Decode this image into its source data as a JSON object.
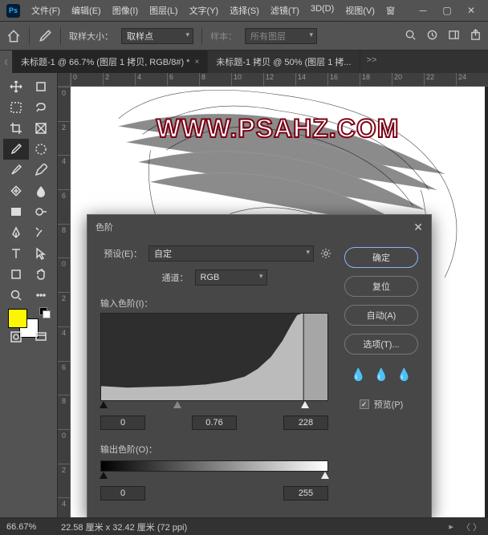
{
  "app": {
    "logo": "Ps"
  },
  "menu": {
    "file": "文件(F)",
    "edit": "编辑(E)",
    "image": "图像(I)",
    "layer": "图层(L)",
    "type": "文字(Y)",
    "select": "选择(S)",
    "filter": "滤镜(T)",
    "three_d": "3D(D)",
    "view": "视图(V)",
    "window": "窗"
  },
  "options": {
    "sample_size_label": "取样大小：",
    "sample_size_value": "取样点",
    "sample_label": "样本：",
    "sample_value": "所有图层"
  },
  "tabs": {
    "t1": "未标题-1 @ 66.7% (图层 1 拷贝, RGB/8#) *",
    "t2": "未标题-1 拷贝 @ 50% (图层 1 拷...",
    "more": ">>"
  },
  "ruler_h": [
    "0",
    "2",
    "4",
    "6",
    "8",
    "10",
    "12",
    "14",
    "16",
    "18",
    "20",
    "22",
    "24"
  ],
  "ruler_v": [
    "0",
    "2",
    "4",
    "6",
    "8",
    "0",
    "2",
    "4",
    "6",
    "8",
    "0",
    "2",
    "4"
  ],
  "watermark": "WWW.PSAHZ.COM",
  "dialog": {
    "title": "色阶",
    "preset_label": "预设(E)：",
    "preset_value": "自定",
    "channel_label": "通道：",
    "channel_value": "RGB",
    "input_label": "输入色阶(I)：",
    "in_black": "0",
    "in_gamma": "0.76",
    "in_white": "228",
    "output_label": "输出色阶(O)：",
    "out_black": "0",
    "out_white": "255",
    "ok": "确定",
    "reset": "复位",
    "auto": "自动(A)",
    "options": "选项(T)...",
    "preview": "预览(P)",
    "preview_checked": "✓"
  },
  "status": {
    "zoom": "66.67%",
    "doc": "22.58 厘米 x 32.42 厘米 (72 ppi)",
    "arrows": "〈   〉"
  }
}
